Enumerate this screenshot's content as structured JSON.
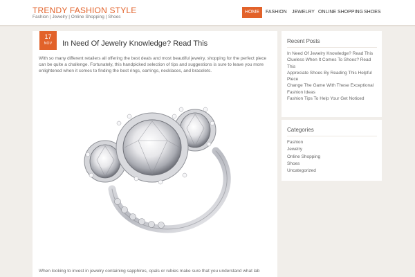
{
  "site": {
    "title": "TRENDY FASHION STYLE",
    "tagline": "Fashion | Jewelry | Online Shopping | Shoes",
    "accent_color": "#e2622a"
  },
  "nav": {
    "items": [
      {
        "label": "HOME",
        "active": true
      },
      {
        "label": "FASHION",
        "active": false
      },
      {
        "label": "JEWELRY",
        "active": false
      },
      {
        "label": "ONLINE SHOPPING",
        "active": false
      },
      {
        "label": "SHOES",
        "active": false
      }
    ]
  },
  "post": {
    "date_day": "17",
    "date_month": "NOV",
    "title": "In Need Of Jewelry Knowledge? Read This",
    "excerpt": "With so many different retailers all offering the best deals and most beautiful jewelry, shopping for the perfect piece can be quite a challenge. Fortunately, this handpicked selection of tips and suggestions is sure to leave you more enlightened when it comes to finding the best rings, earrings, necklaces, and bracelets.",
    "image_icon": "diamond-ring-image",
    "continued": "When looking to invest in jewelry containing sapphires, opals or rubies make sure that you understand what lab"
  },
  "sidebar": {
    "recent": {
      "title": "Recent Posts",
      "items": [
        "In Need Of Jewelry Knowledge? Read This",
        "Clueless When It Comes To Shoes? Read This",
        "Appreciate Shoes By Reading This Helpful Piece",
        "Change The Game With These Exceptional Fashion Ideas",
        "Fashion Tips To Help Your Get Noticed"
      ]
    },
    "categories": {
      "title": "Categories",
      "items": [
        "Fashion",
        "Jewelry",
        "Online Shopping",
        "Shoes",
        "Uncategorized"
      ]
    }
  }
}
